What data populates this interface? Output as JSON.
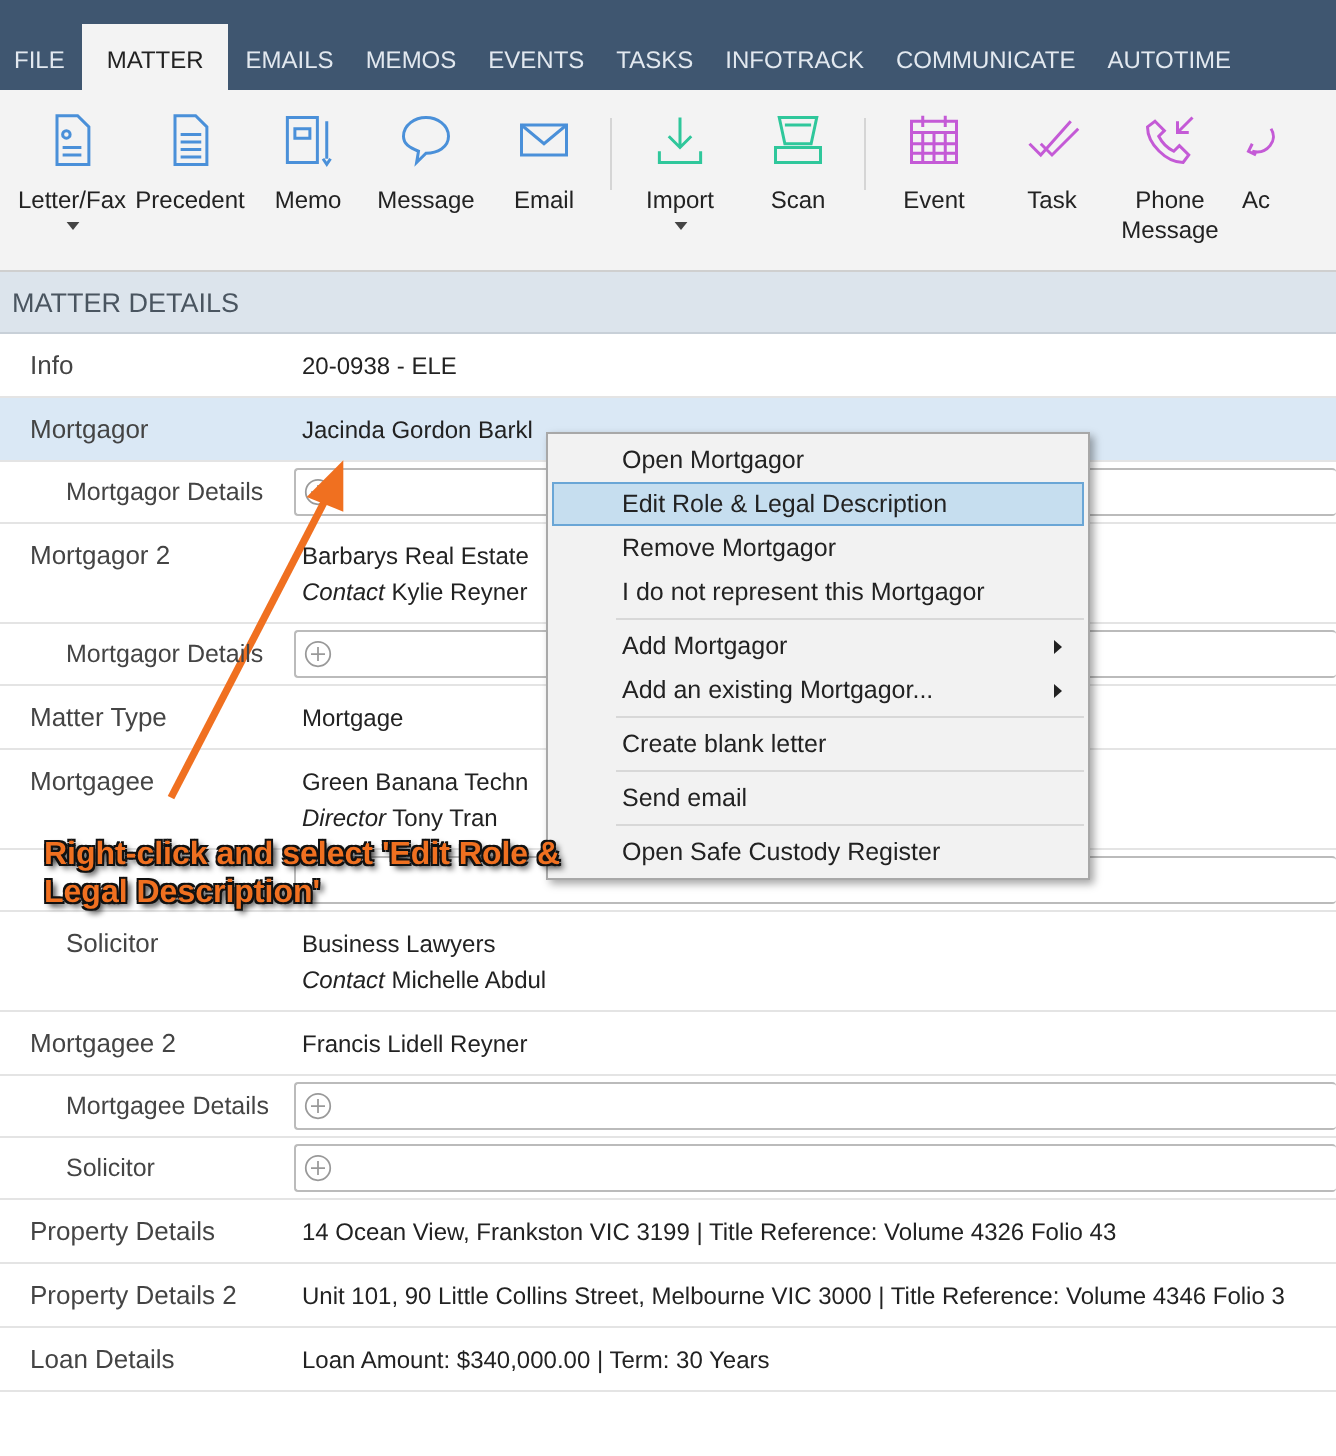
{
  "tabs": [
    {
      "label": "FILE",
      "selected": false
    },
    {
      "label": "MATTER",
      "selected": true
    },
    {
      "label": "EMAILS",
      "selected": false
    },
    {
      "label": "MEMOS",
      "selected": false
    },
    {
      "label": "EVENTS",
      "selected": false
    },
    {
      "label": "TASKS",
      "selected": false
    },
    {
      "label": "INFOTRACK",
      "selected": false
    },
    {
      "label": "COMMUNICATE",
      "selected": false
    },
    {
      "label": "AUTOTIME",
      "selected": false
    }
  ],
  "toolbar": [
    {
      "label": "Letter/Fax",
      "dropdown": true
    },
    {
      "label": "Precedent",
      "dropdown": false
    },
    {
      "label": "Memo",
      "dropdown": false
    },
    {
      "label": "Message",
      "dropdown": false
    },
    {
      "label": "Email",
      "dropdown": false,
      "separator_after": true
    },
    {
      "label": "Import",
      "dropdown": true
    },
    {
      "label": "Scan",
      "dropdown": false,
      "separator_after": true
    },
    {
      "label": "Event",
      "dropdown": false
    },
    {
      "label": "Task",
      "dropdown": false
    },
    {
      "label": "Phone Message",
      "dropdown": false
    },
    {
      "label": "Ac",
      "dropdown": false
    }
  ],
  "section_title": "MATTER DETAILS",
  "rows": [
    {
      "kind": "value",
      "label": "Info",
      "value": "20-0938 - ELE",
      "selected": false
    },
    {
      "kind": "value",
      "label": "Mortgagor",
      "value": "Jacinda Gordon Barkl",
      "selected": true
    },
    {
      "kind": "field",
      "label": "Mortgagor Details",
      "selected": false
    },
    {
      "kind": "contact",
      "label": "Mortgagor 2",
      "value": "Barbarys Real Estate",
      "role": "Contact",
      "person": "Kylie Reyner",
      "selected": false
    },
    {
      "kind": "field",
      "label": "Mortgagor Details",
      "selected": false
    },
    {
      "kind": "value",
      "label": "Matter Type",
      "value": "Mortgage",
      "selected": false
    },
    {
      "kind": "contact",
      "label": "Mortgagee",
      "value": "Green Banana Techn",
      "role": "Director",
      "person": "Tony Tran",
      "selected": false
    },
    {
      "kind": "field",
      "selected": false
    },
    {
      "kind": "sub_contact",
      "label": "Solicitor",
      "value": "Business Lawyers",
      "role": "Contact",
      "person": "Michelle Abdul",
      "selected": false
    },
    {
      "kind": "value",
      "label": "Mortgagee 2",
      "value": "Francis Lidell Reyner",
      "selected": false
    },
    {
      "kind": "field",
      "label": "Mortgagee Details",
      "selected": false
    },
    {
      "kind": "field",
      "label": "Solicitor",
      "selected": false
    },
    {
      "kind": "value",
      "label": "Property Details",
      "value": "14 Ocean View, Frankston VIC 3199 | Title Reference: Volume 4326 Folio 43",
      "selected": false
    },
    {
      "kind": "value",
      "label": "Property Details 2",
      "value": "Unit 101, 90 Little Collins Street, Melbourne VIC 3000 | Title Reference: Volume 4346 Folio 3",
      "selected": false
    },
    {
      "kind": "value",
      "label": "Loan Details",
      "value": "Loan Amount: $340,000.00 | Term: 30 Years",
      "selected": false
    }
  ],
  "context_menu": [
    {
      "kind": "item",
      "label": "Open Mortgagor",
      "selected": false
    },
    {
      "kind": "item",
      "label": "Edit Role & Legal Description",
      "selected": true
    },
    {
      "kind": "item",
      "label": "Remove Mortgagor",
      "selected": false
    },
    {
      "kind": "item",
      "label": "I do not represent this Mortgagor",
      "selected": false
    },
    {
      "kind": "separator"
    },
    {
      "kind": "submenu",
      "label": "Add Mortgagor",
      "selected": false
    },
    {
      "kind": "submenu",
      "label": "Add an existing Mortgagor...",
      "selected": false
    },
    {
      "kind": "separator"
    },
    {
      "kind": "item",
      "label": "Create blank letter",
      "selected": false
    },
    {
      "kind": "separator"
    },
    {
      "kind": "item",
      "label": "Send email",
      "selected": false
    },
    {
      "kind": "separator"
    },
    {
      "kind": "item",
      "label": "Open Safe Custody Register",
      "selected": false
    }
  ],
  "annotation": {
    "text": "Right-click and select 'Edit Role & Legal Description'"
  }
}
